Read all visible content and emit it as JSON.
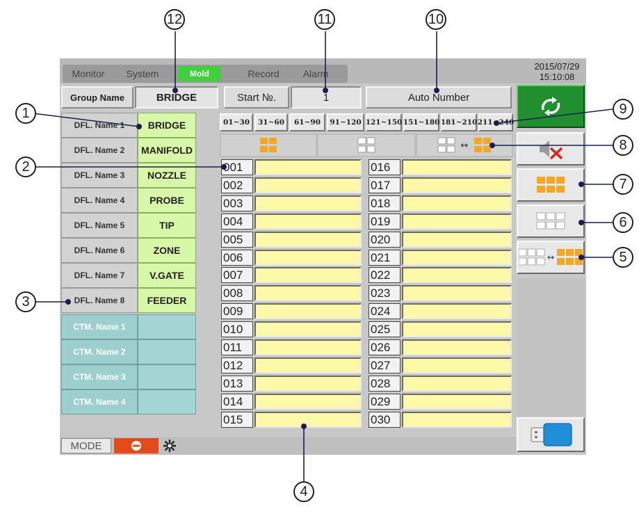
{
  "tabs": [
    {
      "label": "Monitor",
      "active": false
    },
    {
      "label": "System",
      "active": false
    },
    {
      "label": "Mold",
      "active": true
    },
    {
      "label": "Record",
      "active": false
    },
    {
      "label": "Alarm",
      "active": false
    }
  ],
  "clock": {
    "date": "2015/07/29",
    "time": "15:10:08"
  },
  "header": {
    "group_name_label": "Group Name",
    "group_name_value": "BRIDGE",
    "start_no_label": "Start №.",
    "start_no_value": "1",
    "auto_number_label": "Auto Number"
  },
  "dfl_names": [
    {
      "label": "DFL. Name 1",
      "value": "BRIDGE"
    },
    {
      "label": "DFL. Name 2",
      "value": "MANIFOLD"
    },
    {
      "label": "DFL. Name 3",
      "value": "NOZZLE"
    },
    {
      "label": "DFL. Name 4",
      "value": "PROBE"
    },
    {
      "label": "DFL. Name 5",
      "value": "TIP"
    },
    {
      "label": "DFL. Name 6",
      "value": "ZONE"
    },
    {
      "label": "DFL. Name 7",
      "value": "V.GATE"
    },
    {
      "label": "DFL. Name 8",
      "value": "FEEDER"
    }
  ],
  "ctm_names": [
    {
      "label": "CTM. Name 1",
      "value": ""
    },
    {
      "label": "CTM. Name 2",
      "value": ""
    },
    {
      "label": "CTM. Name 3",
      "value": ""
    },
    {
      "label": "CTM. Name 4",
      "value": ""
    }
  ],
  "ranges": [
    "01~30",
    "31~60",
    "61~90",
    "91~120",
    "121~150",
    "151~180",
    "181~210",
    "211~240"
  ],
  "zones_left": [
    "001",
    "002",
    "003",
    "004",
    "005",
    "006",
    "007",
    "008",
    "009",
    "010",
    "011",
    "012",
    "013",
    "014",
    "015"
  ],
  "zones_right": [
    "016",
    "017",
    "018",
    "019",
    "020",
    "021",
    "022",
    "023",
    "024",
    "025",
    "026",
    "027",
    "028",
    "029",
    "030"
  ],
  "status": {
    "mode_label": "MODE"
  },
  "callouts": [
    "1",
    "2",
    "3",
    "4",
    "5",
    "6",
    "7",
    "8",
    "9",
    "10",
    "11",
    "12"
  ],
  "colors": {
    "active_tab": "#3fcf3f",
    "dfl_value_bg": "#d8f7a8",
    "ctm_bg": "#9ecfcf",
    "zone_field": "#fbf8a8",
    "refresh_button": "#1f8f2f",
    "orange_grid": "#f5a623",
    "stop_red": "#e24a1a"
  },
  "icons": [
    "refresh-icon",
    "mute-icon",
    "select-all-grid-icon",
    "clear-grid-icon",
    "swap-grid-icon",
    "usb-icon",
    "stop-icon",
    "fan-icon"
  ]
}
